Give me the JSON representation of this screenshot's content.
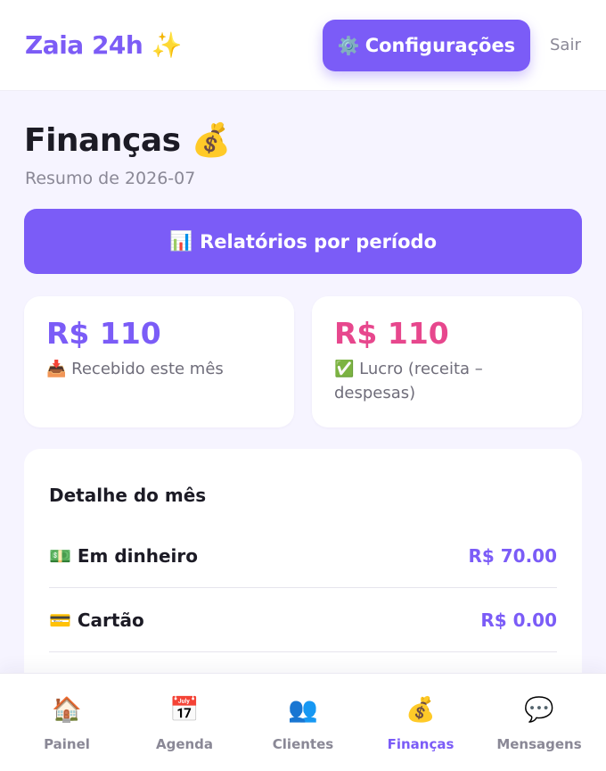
{
  "header": {
    "brand": "Zaia 24h ✨",
    "settings_icon": "⚙️",
    "settings_label": "Configurações",
    "logout_label": "Sair"
  },
  "page": {
    "title": "Finanças 💰",
    "subtitle": "Resumo de 2026-07",
    "reports_icon": "📊",
    "reports_label": "Relatórios por período"
  },
  "stats": [
    {
      "value": "R$ 110",
      "icon": "📥",
      "label": "Recebido este mês",
      "color": "#7b5cf7"
    },
    {
      "value": "R$ 110",
      "icon": "✅",
      "label": "Lucro (receita – despesas)",
      "color": "#e7478d"
    }
  ],
  "detail": {
    "title": "Detalhe do mês",
    "rows": [
      {
        "icon": "💵",
        "label": "Em dinheiro",
        "value": "R$ 70.00"
      },
      {
        "icon": "💳",
        "label": "Cartão",
        "value": "R$ 0.00"
      }
    ]
  },
  "nav": {
    "items": [
      {
        "icon": "🏠",
        "label": "Painel",
        "active": false
      },
      {
        "icon": "📅",
        "label": "Agenda",
        "active": false
      },
      {
        "icon": "👥",
        "label": "Clientes",
        "active": false
      },
      {
        "icon": "💰",
        "label": "Finanças",
        "active": true
      },
      {
        "icon": "💬",
        "label": "Mensagens",
        "active": false
      }
    ]
  },
  "colors": {
    "accent": "#7b5cf7",
    "profit": "#e7478d",
    "background": "#f6f4ff"
  }
}
